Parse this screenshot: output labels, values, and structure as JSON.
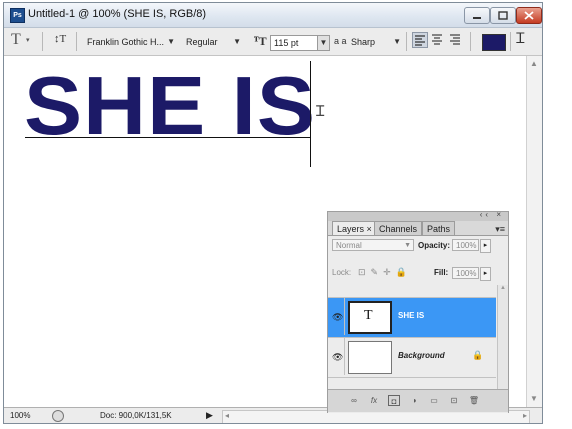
{
  "window": {
    "title": "Untitled-1 @ 100% (SHE IS, RGB/8)",
    "app_icon_text": "Ps"
  },
  "options_bar": {
    "tool_icon": "type-tool-icon",
    "font_family": "Franklin Gothic H...",
    "font_style": "Regular",
    "font_size": "115 pt",
    "aa_label": "a a",
    "anti_alias": "Sharp",
    "text_color": "#1c1a67"
  },
  "canvas": {
    "text": "SHE IS"
  },
  "layers_panel": {
    "tabs": [
      "Layers",
      "Channels",
      "Paths"
    ],
    "close_tab_glyph": "×",
    "blend_mode": "Normal",
    "opacity_label": "Opacity:",
    "opacity_value": "100%",
    "lock_label": "Lock:",
    "fill_label": "Fill:",
    "fill_value": "100%",
    "layers": [
      {
        "name": "SHE IS",
        "thumb": "T",
        "selected": true
      },
      {
        "name": "Background",
        "thumb": "",
        "locked": true
      }
    ]
  },
  "status_bar": {
    "zoom": "100%",
    "doc_info": "Doc: 900,0K/131,5K"
  }
}
